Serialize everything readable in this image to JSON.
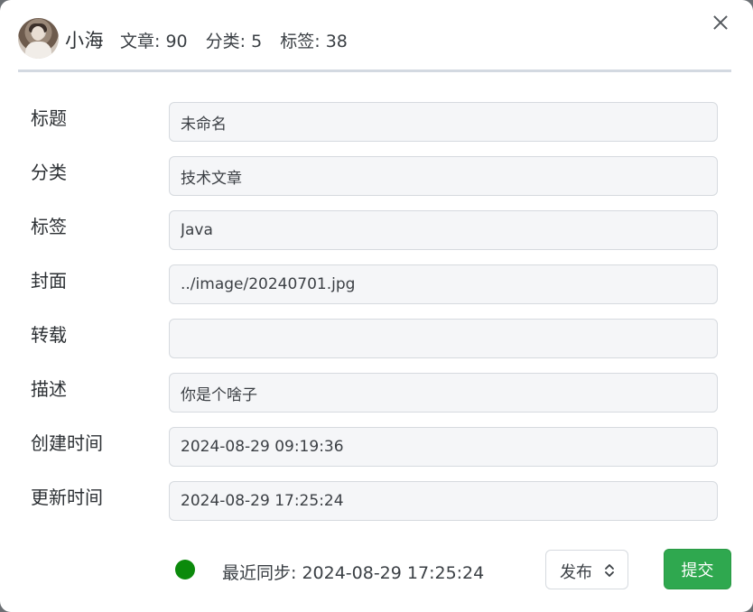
{
  "header": {
    "username": "小海",
    "stats": {
      "articles": "文章: 90",
      "categories": "分类: 5",
      "tags": "标签: 38"
    }
  },
  "form": {
    "title": {
      "label": "标题",
      "value": "未命名"
    },
    "category": {
      "label": "分类",
      "value": "技术文章"
    },
    "tags": {
      "label": "标签",
      "value": "Java"
    },
    "cover": {
      "label": "封面",
      "value": "../image/20240701.jpg"
    },
    "repost": {
      "label": "转载",
      "value": ""
    },
    "description": {
      "label": "描述",
      "value": "你是个啥子"
    },
    "created": {
      "label": "创建时间",
      "value": "2024-08-29 09:19:36"
    },
    "updated": {
      "label": "更新时间",
      "value": "2024-08-29 17:25:24"
    }
  },
  "footer": {
    "status_color": "#0b8a0b",
    "sync_text": "最近同步: 2024-08-29 17:25:24",
    "status_select": "发布",
    "submit_label": "提交"
  },
  "icons": {
    "close": "close-icon",
    "select_chevron": "chevron-up-down-icon",
    "status": "status-dot-icon"
  },
  "colors": {
    "submit_button": "#2fa84f",
    "header_divider": "#d3d9e1",
    "field_background": "#f5f6f8"
  }
}
